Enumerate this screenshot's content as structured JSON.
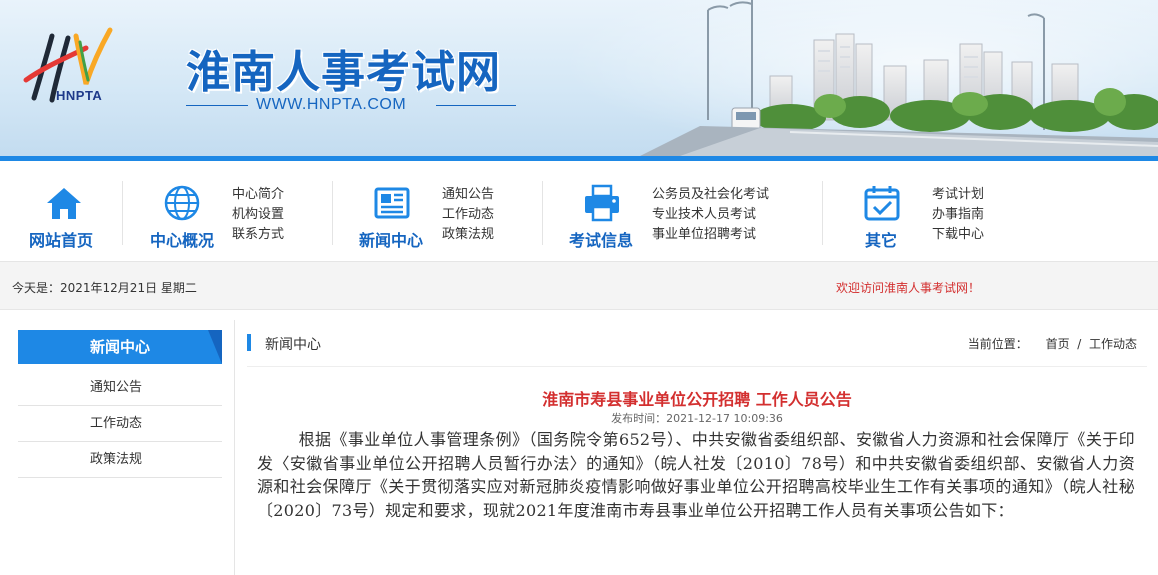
{
  "header": {
    "logo_abbr": "HNPTA",
    "site_title": "淮南人事考试网",
    "site_url": "WWW.HNPTA.COM"
  },
  "nav": {
    "home": {
      "label": "网站首页",
      "icon": "home-icon"
    },
    "about": {
      "label": "中心概况",
      "icon": "globe-icon",
      "links": [
        "中心简介",
        "机构设置",
        "联系方式"
      ]
    },
    "news": {
      "label": "新闻中心",
      "icon": "newspaper-icon",
      "links": [
        "通知公告",
        "工作动态",
        "政策法规"
      ]
    },
    "exam": {
      "label": "考试信息",
      "icon": "printer-icon",
      "links": [
        "公务员及社会化考试",
        "专业技术人员考试",
        "事业单位招聘考试"
      ]
    },
    "other": {
      "label": "其它",
      "icon": "calendar-check-icon",
      "links": [
        "考试计划",
        "办事指南",
        "下载中心"
      ]
    }
  },
  "datebar": {
    "today": "今天是：2021年12月21日 星期二",
    "welcome": "欢迎访问淮南人事考试网！"
  },
  "sidebar": {
    "title": "新闻中心",
    "items": [
      "通知公告",
      "工作动态",
      "政策法规"
    ]
  },
  "main": {
    "section": "新闻中心",
    "breadcrumb": {
      "prefix": "当前位置：",
      "home": "首页",
      "sep": " / ",
      "current": "工作动态"
    },
    "article": {
      "title": "淮南市寿县事业单位公开招聘 工作人员公告",
      "published": "发布时间：2021-12-17 10:09:36",
      "body": "根据《事业单位人事管理条例》（国务院令第652号）、中共安徽省委组织部、安徽省人力资源和社会保障厅《关于印发〈安徽省事业单位公开招聘人员暂行办法〉的通知》（皖人社发〔2010〕78号）和中共安徽省委组织部、安徽省人力资源和社会保障厅《关于贯彻落实应对新冠肺炎疫情影响做好事业单位公开招聘高校毕业生工作有关事项的通知》（皖人社秘〔2020〕73号）规定和要求，现就2021年度淮南市寿县事业单位公开招聘工作人员有关事项公告如下："
    }
  },
  "colors": {
    "primary": "#1e88e5",
    "primary_dark": "#1565c0",
    "accent_red": "#d32f2f"
  }
}
